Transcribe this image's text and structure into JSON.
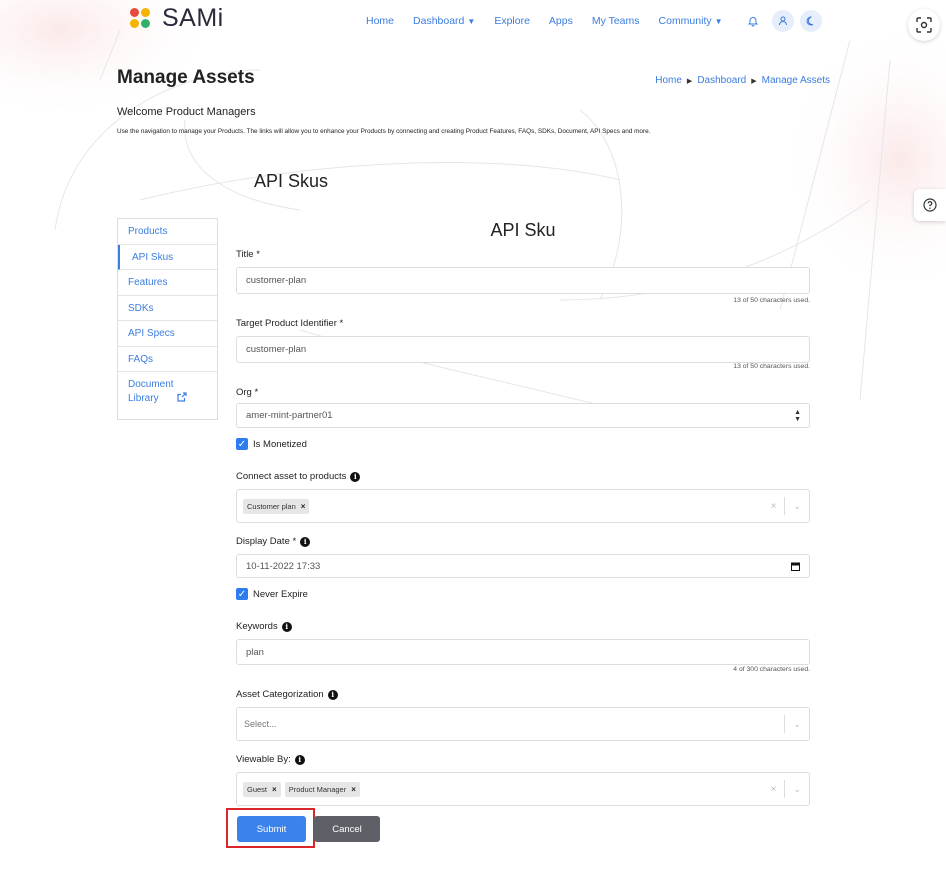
{
  "app": {
    "logo_text": "SAMi"
  },
  "nav": {
    "items": [
      {
        "label": "Home",
        "dropdown": false
      },
      {
        "label": "Dashboard",
        "dropdown": true
      },
      {
        "label": "Explore",
        "dropdown": false
      },
      {
        "label": "Apps",
        "dropdown": false
      },
      {
        "label": "My Teams",
        "dropdown": false
      },
      {
        "label": "Community",
        "dropdown": true
      }
    ],
    "icons": [
      "bell-icon",
      "user-icon",
      "moon-icon"
    ]
  },
  "page": {
    "title": "Manage Assets",
    "breadcrumb": [
      "Home",
      "Dashboard",
      "Manage Assets"
    ],
    "welcome": "Welcome Product Managers",
    "description": "Use the navigation to manage your Products. The links will allow you to enhance your Products by connecting and creating Product Features, FAQs, SDKs, Document, API Specs and more.",
    "section_title": "API Skus"
  },
  "sidebar": {
    "items": [
      {
        "label": "Products"
      },
      {
        "label": "API Skus",
        "active": true
      },
      {
        "label": "Features"
      },
      {
        "label": "SDKs"
      },
      {
        "label": "API Specs"
      },
      {
        "label": "FAQs"
      },
      {
        "label": "Document Library"
      }
    ]
  },
  "form": {
    "title": "API Sku",
    "title_field": {
      "label": "Title *",
      "value": "customer-plan",
      "counter": "13 of 50 characters used."
    },
    "target_field": {
      "label": "Target Product Identifier *",
      "value": "customer-plan",
      "counter": "13 of 50 characters used."
    },
    "org_field": {
      "label": "Org *",
      "value": "amer-mint-partner01"
    },
    "monetized": {
      "label": "Is Monetized",
      "checked": true
    },
    "connect_field": {
      "label": "Connect asset to products",
      "chips": [
        "Customer plan"
      ]
    },
    "display_date": {
      "label": "Display Date *",
      "value": "10-11-2022 17:33"
    },
    "never_expire": {
      "label": "Never Expire",
      "checked": true
    },
    "keywords": {
      "label": "Keywords",
      "value": "plan",
      "counter": "4 of 300 characters used."
    },
    "categorization": {
      "label": "Asset Categorization",
      "placeholder": "Select..."
    },
    "viewable_by": {
      "label": "Viewable By:",
      "chips": [
        "Guest",
        "Product Manager"
      ]
    },
    "submit_label": "Submit",
    "cancel_label": "Cancel"
  },
  "colors": {
    "accent": "#3b7de0",
    "submit": "#3b82ea",
    "cancel": "#5d6167",
    "highlight": "#d9262b"
  }
}
